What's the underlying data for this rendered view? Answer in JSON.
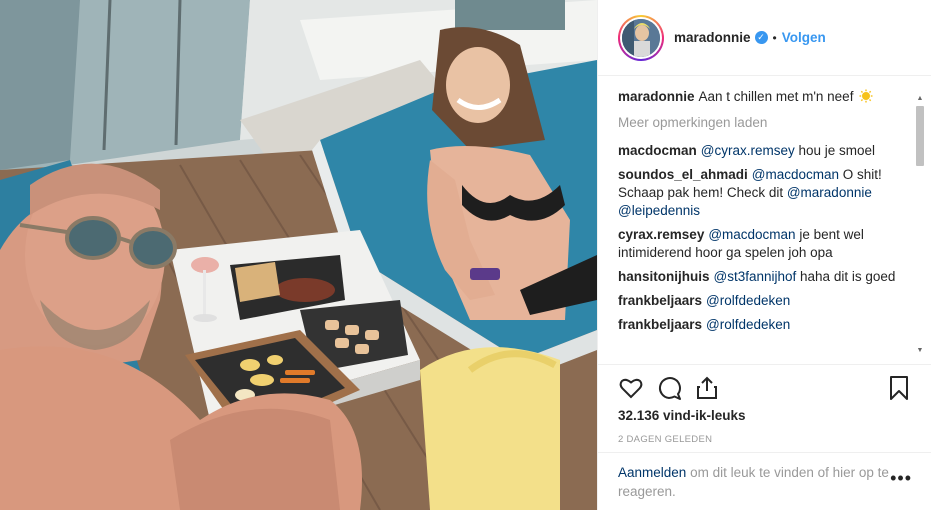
{
  "header": {
    "username": "maradonnie",
    "verified_glyph": "✓",
    "separator": "•",
    "follow_label": "Volgen"
  },
  "caption": {
    "username": "maradonnie",
    "text": "Aan t chillen met m'n neef",
    "emoji_icon": "sun-emoji"
  },
  "load_more_label": "Meer opmerkingen laden",
  "comments": [
    {
      "user": "macdocman",
      "parts": [
        {
          "m": "@cyrax.remsey"
        },
        {
          "t": " hou je smoel"
        }
      ]
    },
    {
      "user": "soundos_el_ahmadi",
      "parts": [
        {
          "m": "@macdocman"
        },
        {
          "t": " O shit! Schaap pak hem! Check dit "
        },
        {
          "m": "@maradonnie"
        },
        {
          "t": " "
        },
        {
          "m": "@leipedennis"
        }
      ]
    },
    {
      "user": "cyrax.remsey",
      "parts": [
        {
          "m": "@macdocman"
        },
        {
          "t": " je bent wel intimiderend hoor ga spelen joh opa"
        }
      ]
    },
    {
      "user": "hansitonijhuis",
      "parts": [
        {
          "m": "@st3fannijhof"
        },
        {
          "t": " haha dit is goed"
        }
      ]
    },
    {
      "user": "frankbeljaars",
      "parts": [
        {
          "m": "@rolfdedeken"
        }
      ]
    },
    {
      "user": "frankbeljaars",
      "parts": [
        {
          "m": "@rolfdedeken"
        }
      ]
    }
  ],
  "scrollbar": {
    "up_glyph": "▲",
    "down_glyph": "▼"
  },
  "actions": {
    "like_icon": "heart-icon",
    "comment_icon": "comment-bubble-icon",
    "share_icon": "share-icon",
    "save_icon": "bookmark-icon"
  },
  "likes_text": "32.136 vind-ik-leuks",
  "timestamp": "2 DAGEN GELEDEN",
  "footer": {
    "login_label": "Aanmelden",
    "rest_text": " om dit leuk te vinden of hier op te reageren.",
    "options_glyph": "•••"
  },
  "colors": {
    "link_blue": "#3897f0",
    "mention": "#003569",
    "muted": "#999999",
    "lounger_teal": "#2f86a8"
  }
}
